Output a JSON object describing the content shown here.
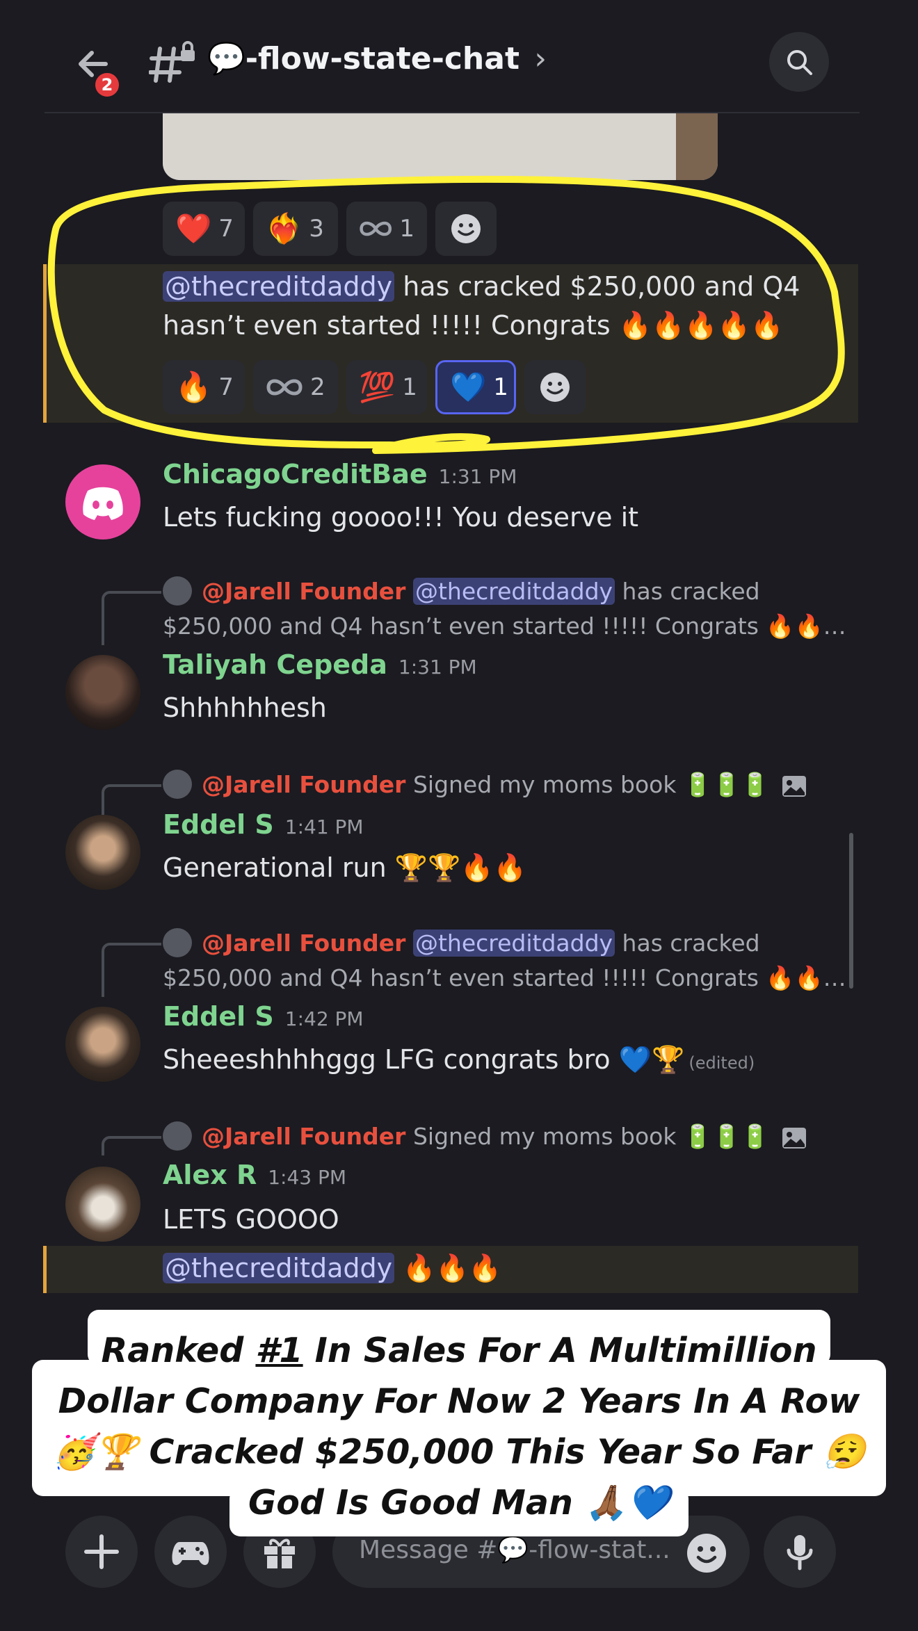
{
  "header": {
    "back_badge": "2",
    "channel_title": "💬-flow-state-chat",
    "chevron": "›",
    "icons": {
      "back": "back-arrow-icon",
      "channel": "locked-hash-icon",
      "search": "search-icon"
    }
  },
  "colors": {
    "accent": "#5865f2",
    "username_green": "#7fd48f",
    "founder_red": "#e8503e",
    "highlight_bar": "#e4a43c",
    "annotation_yellow": "#fff23a"
  },
  "reactions_top": [
    {
      "emoji": "❤️",
      "count": "7"
    },
    {
      "emoji": "❤️‍🔥",
      "count": "3"
    },
    {
      "emoji": "♾️",
      "count": "1"
    }
  ],
  "highlight_message": {
    "mention": "@thecreditdaddy",
    "text_line1": " has cracked $250,000 and Q4",
    "text_line2": "hasn’t even started !!!!! Congrats 🔥🔥🔥🔥🔥"
  },
  "reactions_bottom": [
    {
      "emoji": "🔥",
      "count": "7"
    },
    {
      "emoji": "♾️",
      "count": "2"
    },
    {
      "emoji": "💯",
      "count": "1"
    },
    {
      "emoji": "💙",
      "count": "1",
      "active": true
    }
  ],
  "messages": [
    {
      "author": "ChicagoCreditBae",
      "time": "1:31 PM",
      "text": "Lets fucking goooo!!! You deserve it"
    },
    {
      "reply_name": "@Jarell Founder",
      "reply_mention": "@thecreditdaddy",
      "reply_line1": " has cracked",
      "reply_line2": "$250,000 and Q4 hasn’t even started !!!!! Congrats 🔥🔥…",
      "author": "Taliyah Cepeda",
      "time": "1:31 PM",
      "text": "Shhhhhhesh"
    },
    {
      "reply_name": "@Jarell Founder",
      "reply_text": " Signed  my moms book 🔋🔋🔋",
      "reply_icon": "image-icon",
      "author": "Eddel S",
      "time": "1:41 PM",
      "text": "Generational run 🏆🏆🔥🔥"
    },
    {
      "reply_name": "@Jarell Founder",
      "reply_mention": "@thecreditdaddy",
      "reply_line1": " has cracked",
      "reply_line2": "$250,000 and Q4 hasn’t even started !!!!! Congrats 🔥🔥…",
      "author": "Eddel S",
      "time": "1:42 PM",
      "text": "Sheeeshhhhggg LFG congrats bro  💙🏆",
      "edited": "(edited)"
    },
    {
      "reply_name": "@Jarell Founder",
      "reply_text": " Signed  my moms book 🔋🔋🔋",
      "reply_icon": "image-icon",
      "author": "Alex R",
      "time": "1:43 PM",
      "text": "LETS GOOOO",
      "followup_mention": "@thecreditdaddy",
      "followup_text": " 🔥🔥🔥"
    }
  ],
  "composer": {
    "placeholder": "Message #💬-flow-stat...",
    "icons": [
      "plus-icon",
      "gamepad-icon",
      "gift-icon",
      "emoji-icon",
      "microphone-icon"
    ]
  },
  "caption": {
    "line1_pre": "Ranked ",
    "line1_rank": "#1",
    "line1_post": " In Sales For A Multimillion",
    "line2": "Dollar Company For Now 2 Years In A Row",
    "line3": "🥳🏆 Cracked $250,000 This Year So Far 😮‍💨",
    "line4": "God Is Good Man 🙏🏾💙"
  }
}
